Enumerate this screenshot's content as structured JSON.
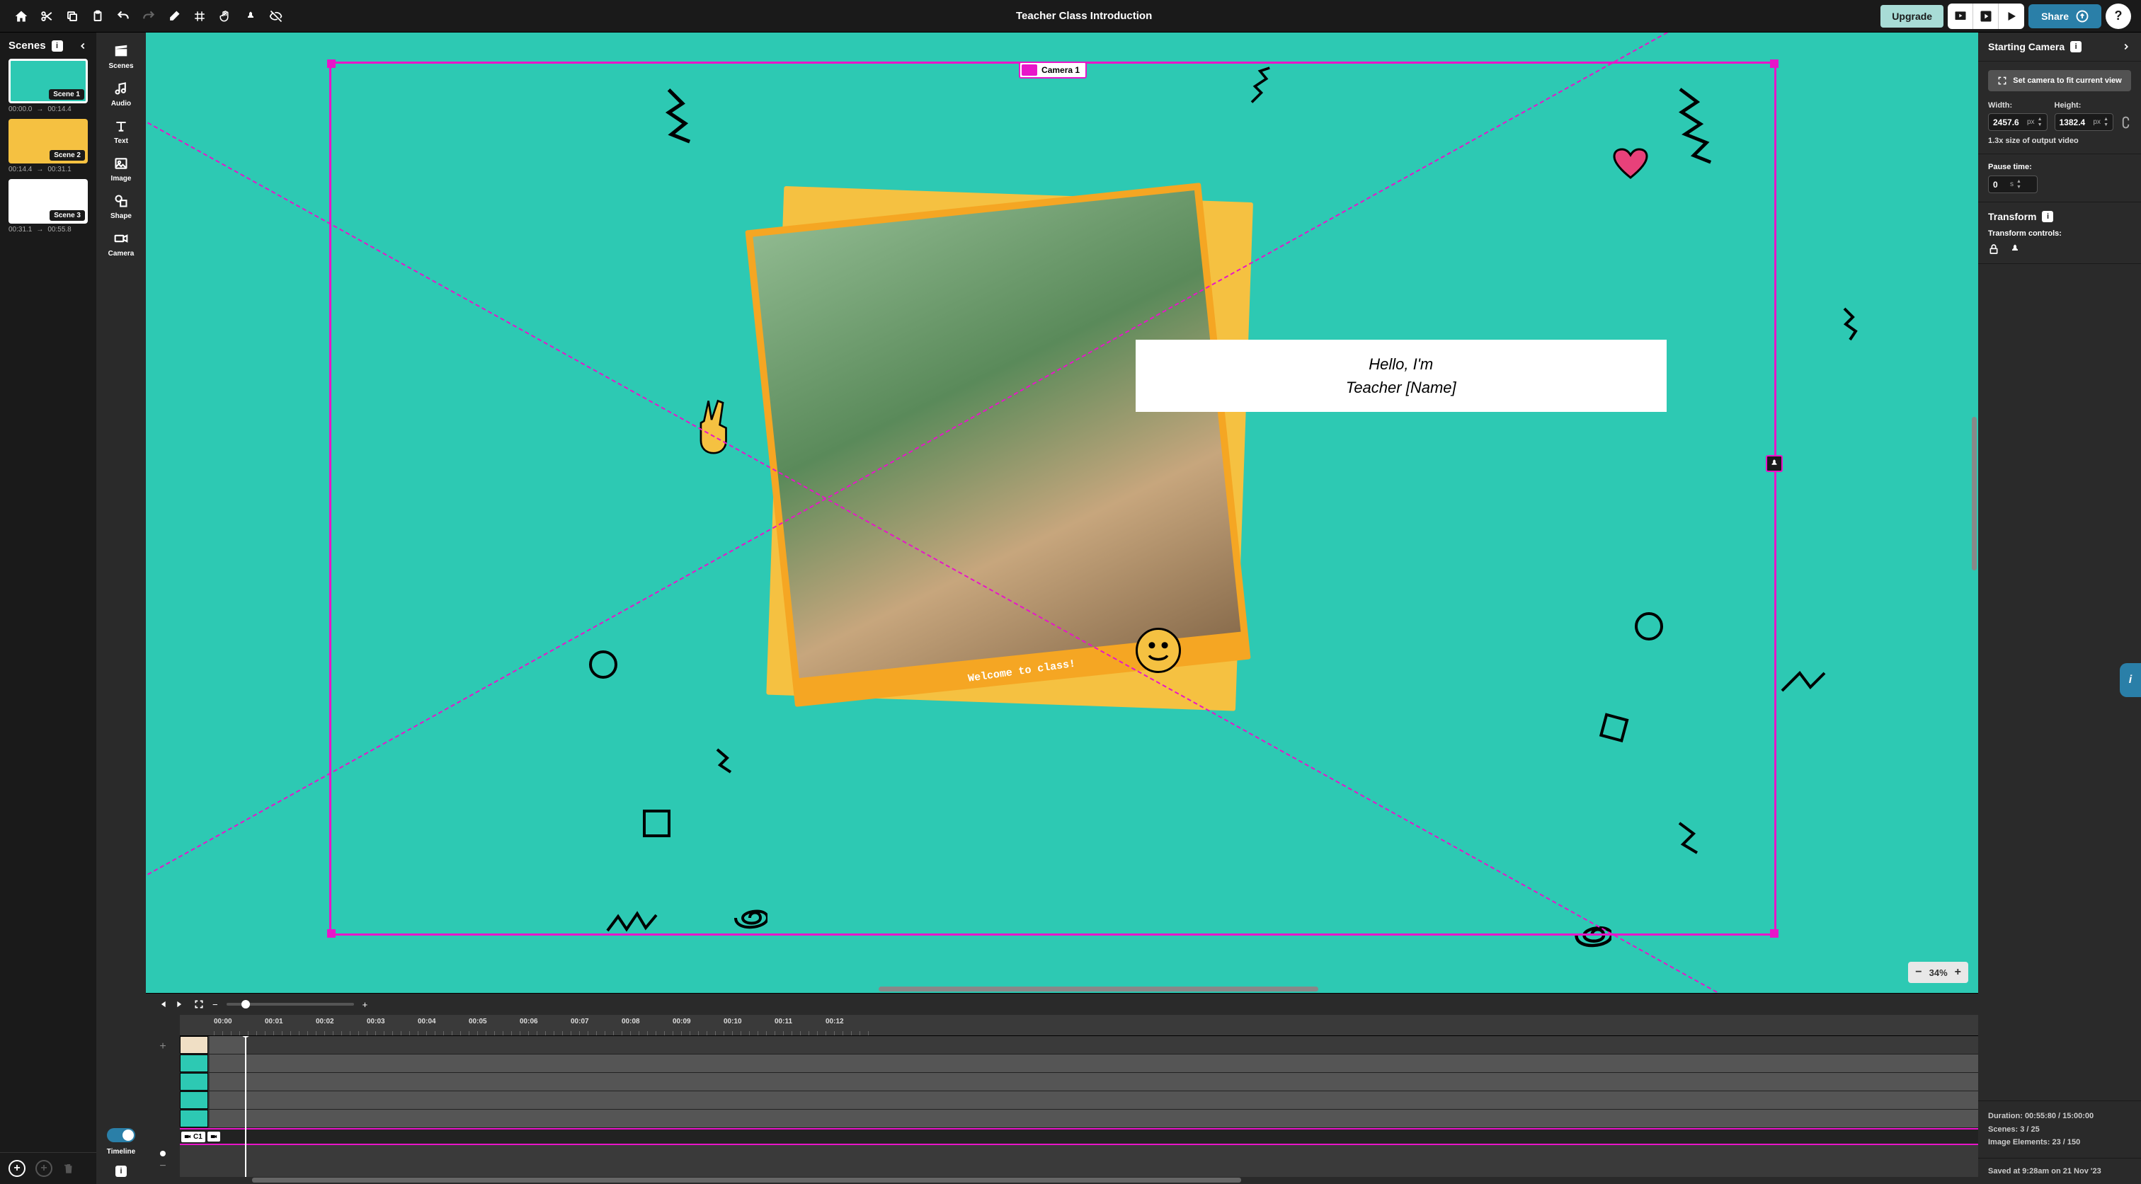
{
  "title": "Teacher Class Introduction",
  "topbar": {
    "upgrade": "Upgrade",
    "share": "Share"
  },
  "scenes_panel": {
    "header": "Scenes",
    "items": [
      {
        "name": "Scene 1",
        "from": "00:00.0",
        "to": "00:14.4",
        "bg": "#2dc9b3",
        "active": true
      },
      {
        "name": "Scene 2",
        "from": "00:14.4",
        "to": "00:31.1",
        "bg": "#f5c141",
        "active": false
      },
      {
        "name": "Scene 3",
        "from": "00:31.1",
        "to": "00:55.8",
        "bg": "#ffffff",
        "active": false
      }
    ]
  },
  "rail": {
    "scenes": "Scenes",
    "audio": "Audio",
    "text": "Text",
    "image": "Image",
    "shape": "Shape",
    "camera": "Camera",
    "timeline": "Timeline"
  },
  "canvas": {
    "camera_label": "Camera 1",
    "speech_line1": "Hello, I'm",
    "speech_line2": "Teacher [Name]",
    "polaroid_caption": "Welcome to class!",
    "zoom": "34%"
  },
  "timeline": {
    "ticks": [
      "00:00",
      "00:01",
      "00:02",
      "00:03",
      "00:04",
      "00:05",
      "00:06",
      "00:07",
      "00:08",
      "00:09",
      "00:10",
      "00:11",
      "00:12"
    ],
    "camera_block": "C1"
  },
  "right": {
    "starting_header": "Starting Camera",
    "fit_btn": "Set camera to fit current view",
    "width_label": "Width:",
    "width_value": "2457.6",
    "height_label": "Height:",
    "height_value": "1382.4",
    "size_hint": "1.3x size of output video",
    "pause_label": "Pause time:",
    "pause_value": "0",
    "pause_unit": "s",
    "px_unit": "px",
    "transform_header": "Transform",
    "transform_sub": "Transform controls:"
  },
  "status": {
    "duration": "Duration: 00:55:80 / 15:00:00",
    "scenes": "Scenes: 3 / 25",
    "images": "Image Elements: 23 / 150",
    "saved": "Saved at 9:28am on 21 Nov '23"
  }
}
